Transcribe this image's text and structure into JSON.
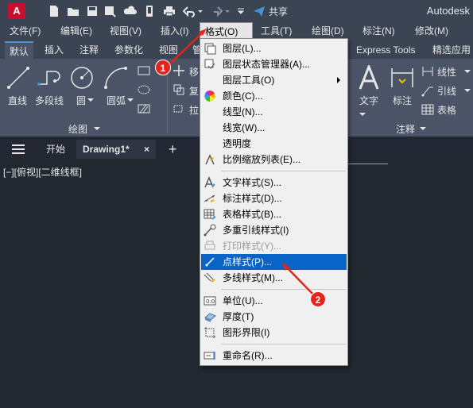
{
  "app": {
    "logo_letter": "A",
    "share_label": "共享",
    "name": "Autodesk"
  },
  "menubar": {
    "items": [
      "文件(F)",
      "编辑(E)",
      "视图(V)",
      "插入(I)",
      "格式(O)",
      "工具(T)",
      "绘图(D)",
      "标注(N)",
      "修改(M)"
    ]
  },
  "ribbon_tabs": [
    "默认",
    "插入",
    "注释",
    "参数化",
    "视图",
    "管",
    "Express Tools",
    "精选应用"
  ],
  "ribbon": {
    "draw_tools": [
      "直线",
      "多段线",
      "圆",
      "圆弧"
    ],
    "draw_panel_title": "绘图",
    "modify_partial": [
      "移",
      "复",
      "拉"
    ],
    "annotation_tools": [
      "文字",
      "标注"
    ],
    "annotation_side": [
      "线性",
      "引线",
      "表格"
    ],
    "annotation_panel_title": "注释"
  },
  "file_tabs": {
    "start": "开始",
    "current": "Drawing1*",
    "close_glyph": "×",
    "add_glyph": "+"
  },
  "viewport_label": "[−][俯视][二维线框]",
  "format_menu": {
    "items": [
      {
        "label": "图层(L)...",
        "icon": "layer-icon"
      },
      {
        "label": "图层状态管理器(A)...",
        "icon": "layer-state-icon"
      },
      {
        "label": "图层工具(O)",
        "icon": "none",
        "submenu": true
      },
      {
        "label": "颜色(C)...",
        "icon": "color-wheel-icon"
      },
      {
        "label": "线型(N)...",
        "icon": "none"
      },
      {
        "label": "线宽(W)...",
        "icon": "none"
      },
      {
        "label": "透明度",
        "icon": "none"
      },
      {
        "label": "比例缩放列表(E)...",
        "icon": "scale-list-icon"
      },
      {
        "label": "文字样式(S)...",
        "icon": "text-style-icon"
      },
      {
        "label": "标注样式(D)...",
        "icon": "dim-style-icon"
      },
      {
        "label": "表格样式(B)...",
        "icon": "table-style-icon"
      },
      {
        "label": "多重引线样式(I)",
        "icon": "mleader-style-icon"
      },
      {
        "label": "打印样式(Y)...",
        "icon": "plot-style-icon",
        "disabled": true
      },
      {
        "label": "点样式(P)...",
        "icon": "point-style-icon",
        "highlighted": true
      },
      {
        "label": "多线样式(M)...",
        "icon": "mline-style-icon"
      },
      {
        "label": "单位(U)...",
        "icon": "units-icon"
      },
      {
        "label": "厚度(T)",
        "icon": "thickness-icon"
      },
      {
        "label": "图形界限(I)",
        "icon": "limits-icon"
      },
      {
        "label": "重命名(R)...",
        "icon": "rename-icon"
      }
    ]
  },
  "annotations": {
    "badge_1": "1",
    "badge_2": "2"
  },
  "colors": {
    "highlight": "#0a64c8",
    "annotation_red": "#e2261d",
    "brand_red": "#c8102e"
  }
}
